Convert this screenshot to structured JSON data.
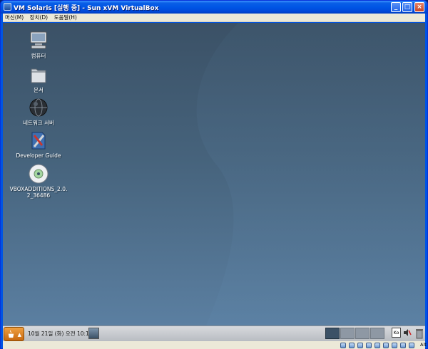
{
  "window": {
    "title": "VM Solaris [실행 중] - Sun xVM VirtualBox",
    "minimize": "_",
    "maximize": "□",
    "close": "×"
  },
  "menu": {
    "items": [
      {
        "label": "머신(M)"
      },
      {
        "label": "장치(D)"
      },
      {
        "label": "도움말(H)"
      }
    ]
  },
  "desktop": {
    "icons": [
      {
        "label": "컴퓨터",
        "icon": "computer-icon"
      },
      {
        "label": "문서",
        "icon": "documents-folder-icon"
      },
      {
        "label": "네트워크 서버",
        "icon": "network-globe-icon"
      },
      {
        "label": "Developer Guide",
        "icon": "developer-guide-icon"
      },
      {
        "label": "VBOXADDITIONS_2.0.\n2_36486",
        "icon": "cd-disc-icon"
      }
    ],
    "background_colors": [
      "#3b5166",
      "#46637c",
      "#5b7fa1"
    ]
  },
  "panel": {
    "clock": "10월 21일 (화) 오전 10:14",
    "launch_arrow": "▲",
    "keyboard_indicator": "Ko",
    "workspaces": [
      {
        "active": true
      },
      {
        "active": false
      },
      {
        "active": false
      },
      {
        "active": false
      }
    ]
  },
  "statusbar": {
    "host_key": "Alt",
    "icons": [
      "hard-disk-icon",
      "cd-icon",
      "floppy-icon",
      "network-icon",
      "usb-icon",
      "shared-folder-icon",
      "display-icon",
      "mouse-integration-icon"
    ]
  }
}
